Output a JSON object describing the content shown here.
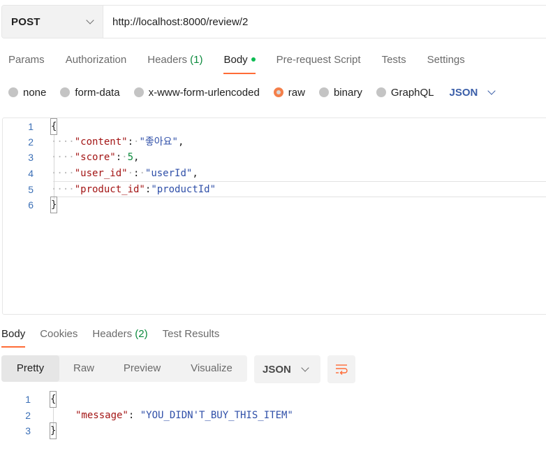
{
  "request": {
    "method": "POST",
    "url": "http://localhost:8000/review/2"
  },
  "request_tabs": [
    {
      "label": "Params"
    },
    {
      "label": "Authorization"
    },
    {
      "label": "Headers",
      "count": "(1)"
    },
    {
      "label": "Body"
    },
    {
      "label": "Pre-request Script"
    },
    {
      "label": "Tests"
    },
    {
      "label": "Settings"
    }
  ],
  "body_types": [
    "none",
    "form-data",
    "x-www-form-urlencoded",
    "raw",
    "binary",
    "GraphQL"
  ],
  "body_format": "JSON",
  "editor": {
    "line_numbers": [
      "1",
      "2",
      "3",
      "4",
      "5",
      "6"
    ],
    "lines": {
      "open": "{",
      "content_key": "\"content\"",
      "content_value": "\"좋아요\"",
      "score_key": "\"score\"",
      "score_value": "5",
      "user_key": "\"user_id\"",
      "user_value": "\"userId\"",
      "product_key": "\"product_id\"",
      "product_value": "\"productId\"",
      "close": "}"
    }
  },
  "response_tabs": [
    {
      "label": "Body"
    },
    {
      "label": "Cookies"
    },
    {
      "label": "Headers",
      "count": "(2)"
    },
    {
      "label": "Test Results"
    }
  ],
  "response_views": [
    "Pretty",
    "Raw",
    "Preview",
    "Visualize"
  ],
  "response_format": "JSON",
  "response": {
    "line_numbers": [
      "1",
      "2",
      "3"
    ],
    "open": "{",
    "message_key": "\"message\"",
    "message_value": "\"YOU_DIDN'T_BUY_THIS_ITEM\"",
    "close": "}"
  },
  "colors": {
    "accent": "#ff6c37",
    "status_dot": "#0cbb52",
    "json_key": "#a31515",
    "json_string": "#2f4fa8"
  },
  "icons": {
    "method_dropdown": "chevron-down-icon",
    "wrap": "wrap-lines-icon"
  }
}
